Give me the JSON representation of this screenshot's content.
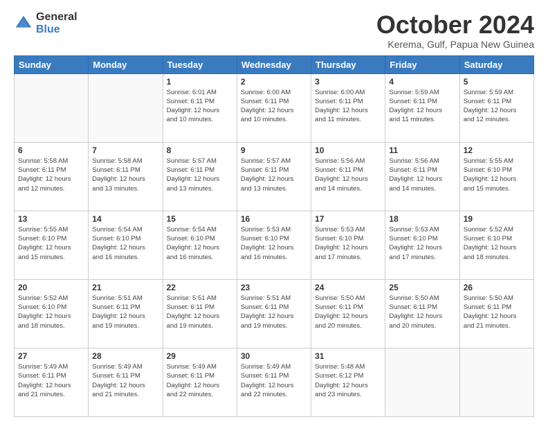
{
  "header": {
    "logo_general": "General",
    "logo_blue": "Blue",
    "month_title": "October 2024",
    "location": "Kerema, Gulf, Papua New Guinea"
  },
  "calendar": {
    "days_of_week": [
      "Sunday",
      "Monday",
      "Tuesday",
      "Wednesday",
      "Thursday",
      "Friday",
      "Saturday"
    ],
    "weeks": [
      [
        {
          "day": "",
          "info": ""
        },
        {
          "day": "",
          "info": ""
        },
        {
          "day": "1",
          "info": "Sunrise: 6:01 AM\nSunset: 6:11 PM\nDaylight: 12 hours\nand 10 minutes."
        },
        {
          "day": "2",
          "info": "Sunrise: 6:00 AM\nSunset: 6:11 PM\nDaylight: 12 hours\nand 10 minutes."
        },
        {
          "day": "3",
          "info": "Sunrise: 6:00 AM\nSunset: 6:11 PM\nDaylight: 12 hours\nand 11 minutes."
        },
        {
          "day": "4",
          "info": "Sunrise: 5:59 AM\nSunset: 6:11 PM\nDaylight: 12 hours\nand 11 minutes."
        },
        {
          "day": "5",
          "info": "Sunrise: 5:59 AM\nSunset: 6:11 PM\nDaylight: 12 hours\nand 12 minutes."
        }
      ],
      [
        {
          "day": "6",
          "info": "Sunrise: 5:58 AM\nSunset: 6:11 PM\nDaylight: 12 hours\nand 12 minutes."
        },
        {
          "day": "7",
          "info": "Sunrise: 5:58 AM\nSunset: 6:11 PM\nDaylight: 12 hours\nand 13 minutes."
        },
        {
          "day": "8",
          "info": "Sunrise: 5:57 AM\nSunset: 6:11 PM\nDaylight: 12 hours\nand 13 minutes."
        },
        {
          "day": "9",
          "info": "Sunrise: 5:57 AM\nSunset: 6:11 PM\nDaylight: 12 hours\nand 13 minutes."
        },
        {
          "day": "10",
          "info": "Sunrise: 5:56 AM\nSunset: 6:11 PM\nDaylight: 12 hours\nand 14 minutes."
        },
        {
          "day": "11",
          "info": "Sunrise: 5:56 AM\nSunset: 6:11 PM\nDaylight: 12 hours\nand 14 minutes."
        },
        {
          "day": "12",
          "info": "Sunrise: 5:55 AM\nSunset: 6:10 PM\nDaylight: 12 hours\nand 15 minutes."
        }
      ],
      [
        {
          "day": "13",
          "info": "Sunrise: 5:55 AM\nSunset: 6:10 PM\nDaylight: 12 hours\nand 15 minutes."
        },
        {
          "day": "14",
          "info": "Sunrise: 5:54 AM\nSunset: 6:10 PM\nDaylight: 12 hours\nand 16 minutes."
        },
        {
          "day": "15",
          "info": "Sunrise: 5:54 AM\nSunset: 6:10 PM\nDaylight: 12 hours\nand 16 minutes."
        },
        {
          "day": "16",
          "info": "Sunrise: 5:53 AM\nSunset: 6:10 PM\nDaylight: 12 hours\nand 16 minutes."
        },
        {
          "day": "17",
          "info": "Sunrise: 5:53 AM\nSunset: 6:10 PM\nDaylight: 12 hours\nand 17 minutes."
        },
        {
          "day": "18",
          "info": "Sunrise: 5:53 AM\nSunset: 6:10 PM\nDaylight: 12 hours\nand 17 minutes."
        },
        {
          "day": "19",
          "info": "Sunrise: 5:52 AM\nSunset: 6:10 PM\nDaylight: 12 hours\nand 18 minutes."
        }
      ],
      [
        {
          "day": "20",
          "info": "Sunrise: 5:52 AM\nSunset: 6:10 PM\nDaylight: 12 hours\nand 18 minutes."
        },
        {
          "day": "21",
          "info": "Sunrise: 5:51 AM\nSunset: 6:11 PM\nDaylight: 12 hours\nand 19 minutes."
        },
        {
          "day": "22",
          "info": "Sunrise: 5:51 AM\nSunset: 6:11 PM\nDaylight: 12 hours\nand 19 minutes."
        },
        {
          "day": "23",
          "info": "Sunrise: 5:51 AM\nSunset: 6:11 PM\nDaylight: 12 hours\nand 19 minutes."
        },
        {
          "day": "24",
          "info": "Sunrise: 5:50 AM\nSunset: 6:11 PM\nDaylight: 12 hours\nand 20 minutes."
        },
        {
          "day": "25",
          "info": "Sunrise: 5:50 AM\nSunset: 6:11 PM\nDaylight: 12 hours\nand 20 minutes."
        },
        {
          "day": "26",
          "info": "Sunrise: 5:50 AM\nSunset: 6:11 PM\nDaylight: 12 hours\nand 21 minutes."
        }
      ],
      [
        {
          "day": "27",
          "info": "Sunrise: 5:49 AM\nSunset: 6:11 PM\nDaylight: 12 hours\nand 21 minutes."
        },
        {
          "day": "28",
          "info": "Sunrise: 5:49 AM\nSunset: 6:11 PM\nDaylight: 12 hours\nand 21 minutes."
        },
        {
          "day": "29",
          "info": "Sunrise: 5:49 AM\nSunset: 6:11 PM\nDaylight: 12 hours\nand 22 minutes."
        },
        {
          "day": "30",
          "info": "Sunrise: 5:49 AM\nSunset: 6:11 PM\nDaylight: 12 hours\nand 22 minutes."
        },
        {
          "day": "31",
          "info": "Sunrise: 5:48 AM\nSunset: 6:12 PM\nDaylight: 12 hours\nand 23 minutes."
        },
        {
          "day": "",
          "info": ""
        },
        {
          "day": "",
          "info": ""
        }
      ]
    ]
  }
}
